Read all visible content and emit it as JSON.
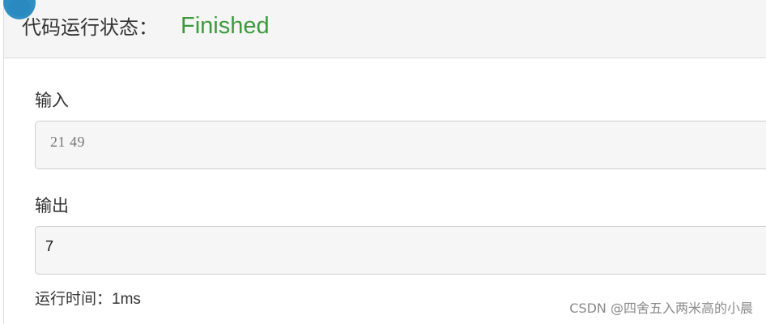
{
  "header": {
    "status_label": "代码运行状态：",
    "status_value": "Finished",
    "status_color": "#3c9a3c"
  },
  "input": {
    "label": "输入",
    "value": "21 49"
  },
  "output": {
    "label": "输出",
    "value": "7"
  },
  "runtime": {
    "label": "运行时间：",
    "value": "1ms"
  },
  "watermark": "CSDN @四舍五入两米高的小晨",
  "icons": {
    "avatar": "avatar-icon"
  }
}
